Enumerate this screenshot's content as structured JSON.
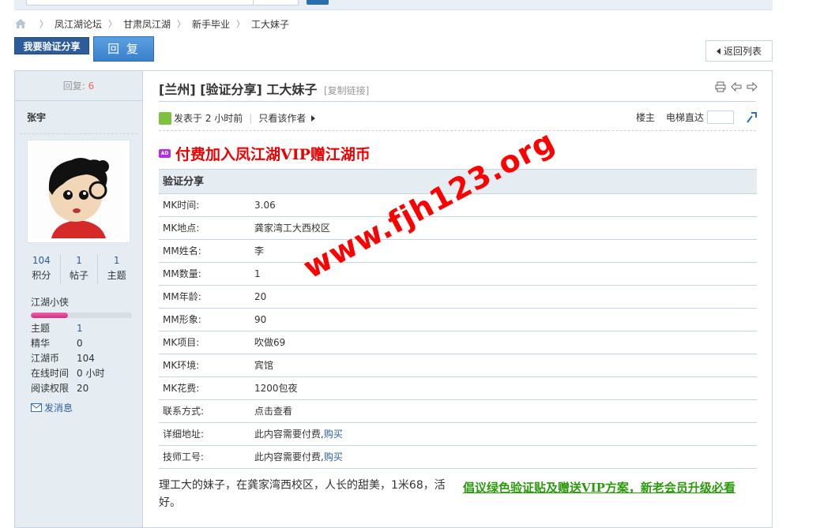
{
  "breadcrumb": [
    "凤江湖论坛",
    "甘肃凤江湖",
    "新手毕业",
    "工大妹子"
  ],
  "buttons": {
    "share": "我要验证分享",
    "reply": "回 复",
    "back": "返回列表"
  },
  "sidebar": {
    "replies_label": "回复:",
    "replies_count": "6",
    "username": "张宇",
    "stats": [
      {
        "value": "104",
        "label": "积分"
      },
      {
        "value": "1",
        "label": "帖子"
      },
      {
        "value": "1",
        "label": "主题"
      }
    ],
    "rank": "江湖小侠",
    "rank_progress": 0.37,
    "info": [
      {
        "key": "主题",
        "value": "1"
      },
      {
        "key": "精华",
        "value": "0"
      },
      {
        "key": "江湖币",
        "value": "104"
      },
      {
        "key": "在线时间",
        "value": "0 小时"
      },
      {
        "key": "阅读权限",
        "value": "20"
      }
    ],
    "message": "发消息"
  },
  "post": {
    "title": "[兰州] [验证分享] 工大妹子",
    "copy_link": "[复制链接]",
    "posted": "发表于 2 小时前",
    "only_author": "只看该作者",
    "floor": "楼主",
    "jump": "电梯直达",
    "ad_badge": "AD",
    "ad_text": "付费加入凤江湖VIP赠江湖币",
    "table_head": "验证分享",
    "rows": [
      {
        "k": "MK时间:",
        "v": "3.06"
      },
      {
        "k": "MK地点:",
        "v": "龚家湾工大西校区"
      },
      {
        "k": "MM姓名:",
        "v": "李"
      },
      {
        "k": "MM数量:",
        "v": "1"
      },
      {
        "k": "MM年龄:",
        "v": "20"
      },
      {
        "k": "MM形象:",
        "v": "90"
      },
      {
        "k": "MK项目:",
        "v": "吹做69"
      },
      {
        "k": "MK环境:",
        "v": "宾馆"
      },
      {
        "k": "MK花费:",
        "v": "1200包夜"
      },
      {
        "k": "联系方式:",
        "v": "点击查看"
      },
      {
        "k": "详细地址:",
        "v": "此内容需要付费,",
        "link": "购买"
      },
      {
        "k": "技师工号:",
        "v": "此内容需要付费,",
        "link": "购买"
      }
    ],
    "body": "理工大的妹子，在龚家湾西校区，人长的甜美，1米68，活好。",
    "promo": "倡议绿色验证贴及赠送VIP方案，新老会员升级必看",
    "watermark": "www.fjh123.org"
  }
}
